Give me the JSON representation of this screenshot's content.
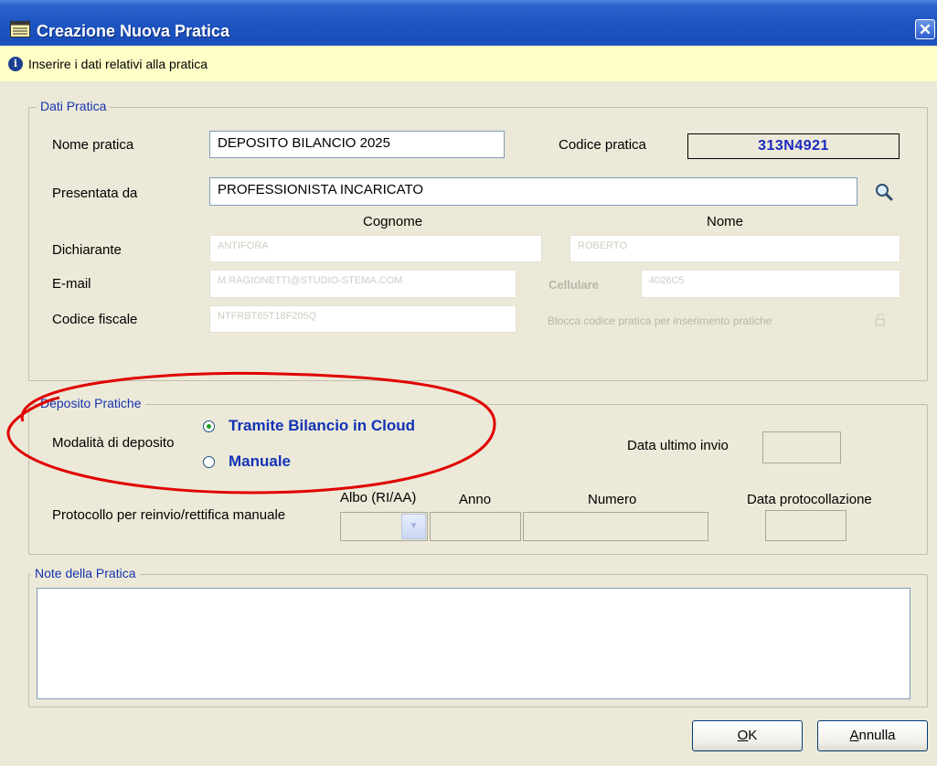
{
  "window": {
    "title": "Creazione Nuova Pratica",
    "close_label": "✕"
  },
  "infobar": {
    "message": "Inserire i dati relativi alla pratica"
  },
  "dati_pratica": {
    "legend": "Dati Pratica",
    "nome_label": "Nome pratica",
    "nome_value": "DEPOSITO BILANCIO 2025",
    "codice_label": "Codice pratica",
    "codice_value": "313N4921",
    "presentata_label": "Presentata da",
    "presentata_value": "PROFESSIONISTA INCARICATO",
    "cognome_header": "Cognome",
    "nome_header": "Nome",
    "dichiarante_label": "Dichiarante",
    "dichiarante_cognome": "ANTIFORA",
    "dichiarante_nome": "ROBERTO",
    "email_label": "E-mail",
    "email_value": "M.RAGIONETTI@STUDIO-STEMA.COM",
    "cellulare_label": "Cellulare",
    "cellulare_value": "4026C5",
    "cf_label": "Codice fiscale",
    "cf_value": "NTFRBT65T18F205Q",
    "blocca_label": "Blocca codice pratica per inserimento pratiche"
  },
  "deposito": {
    "legend": "Deposito Pratiche",
    "modalita_label": "Modalità di deposito",
    "options": [
      {
        "label": "Tramite Bilancio in Cloud",
        "selected": true
      },
      {
        "label": "Manuale",
        "selected": false
      }
    ],
    "data_ultimo_label": "Data ultimo invio",
    "protocollo_label": "Protocollo per reinvio/rettifica manuale",
    "albo_header": "Albo (RI/AA)",
    "anno_header": "Anno",
    "numero_header": "Numero",
    "data_prot_header": "Data protocollazione"
  },
  "note": {
    "legend": "Note della Pratica",
    "value": ""
  },
  "buttons": {
    "ok_mnemonic": "O",
    "ok_rest": "K",
    "annulla_mnemonic": "A",
    "annulla_rest": "nnulla"
  },
  "colors": {
    "title_bar": "#1e55c2",
    "legend_text": "#1533b0",
    "radio_text": "#1233b5",
    "highlight_oval": "#e00000",
    "info_bar": "#ffffc7"
  }
}
